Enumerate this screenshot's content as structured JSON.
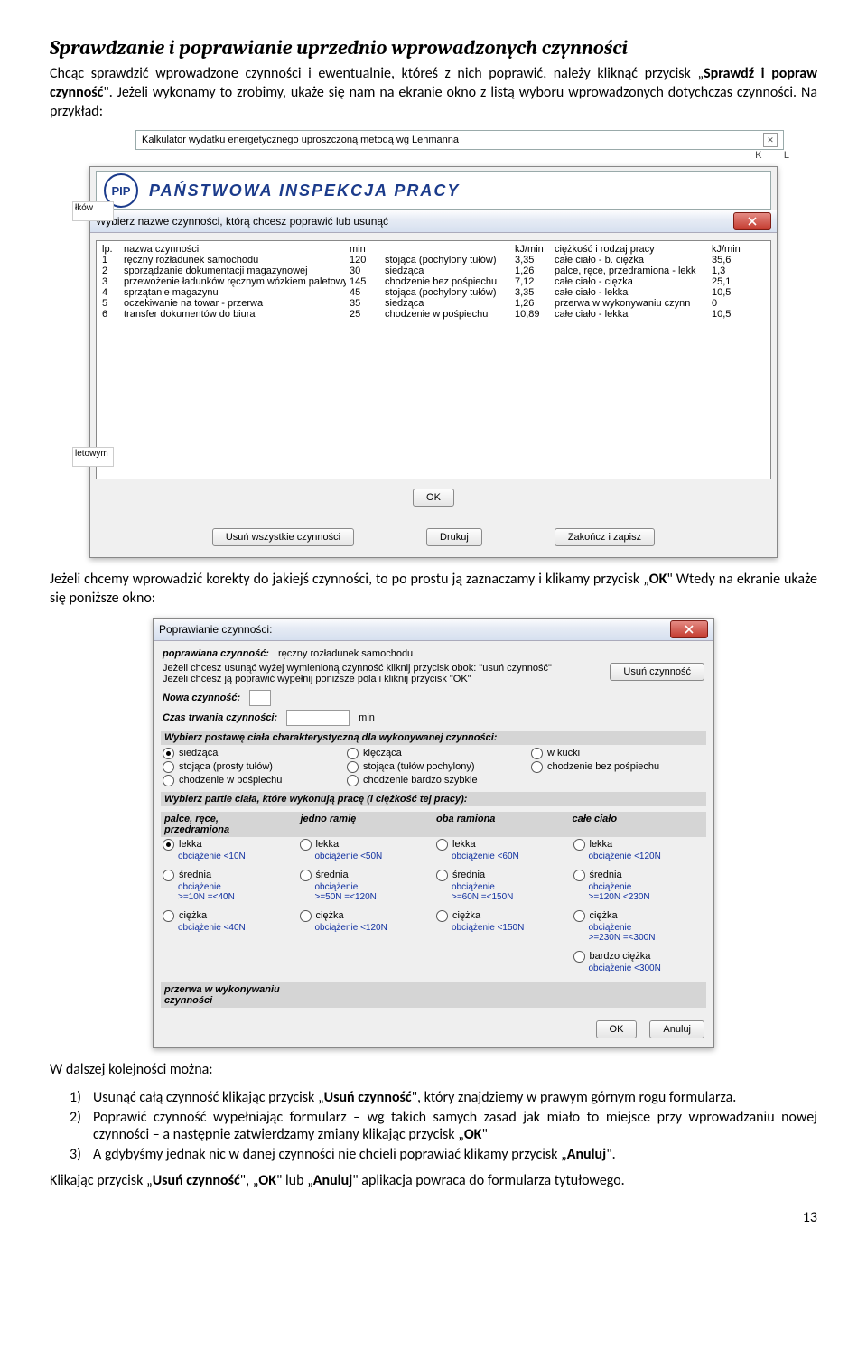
{
  "doc": {
    "heading": "Sprawdzanie i poprawianie uprzednio wprowadzonych czynności",
    "para1a": "Chcąc sprawdzić  wprowadzone czynności i ewentualnie, któreś z nich poprawić, należy kliknąć przycisk „",
    "para1b": "Sprawdź i popraw czynność",
    "para1c": "\". Jeżeli wykonamy to zrobimy, ukaże się nam na ekranie okno z listą wyboru wprowadzonych dotychczas czynności. Na przykład:",
    "para2a": "Jeżeli chcemy  wprowadzić korekty do jakiejś czynności, to po prostu ją zaznaczamy i klikamy przycisk „",
    "para2b": "OK",
    "para2c": "\"  Wtedy na ekranie ukaże się poniższe okno:",
    "para3": "W dalszej kolejności można:",
    "li1a": "Usunąć całą czynność klikając przycisk „",
    "li1b": "Usuń czynność",
    "li1c": "\", który znajdziemy  w prawym górnym rogu formularza.",
    "li2a": "Poprawić czynność wypełniając formularz – wg takich samych zasad jak miało to miejsce przy wprowadzaniu nowej czynności – a następnie zatwierdzamy zmiany klikając przycisk „",
    "li2b": "OK",
    "li2c": "\"",
    "li3a": "A gdybyśmy jednak nic w danej czynności nie chcieli poprawiać klikamy przycisk „",
    "li3b": "Anuluj",
    "li3c": "\".",
    "para4a": "Klikając przycisk  „",
    "para4b": "Usuń czynność",
    "para4c": "\", „",
    "para4d": "OK",
    "para4e": "\" lub „",
    "para4f": "Anuluj",
    "para4g": "\" aplikacja powraca do formularza tytułowego.",
    "pagenum": "13"
  },
  "outer": {
    "title": "Kalkulator wydatku energetycznego uproszczoną metodą wg Lehmanna",
    "colK": "K",
    "colL": "L",
    "stub1": "łków",
    "stub2": "letowym"
  },
  "dlg1": {
    "pip": "PAŃSTWOWA INSPEKCJA PRACY",
    "title": "Wybierz nazwe czynności, którą chcesz poprawić lub usunąć",
    "headers": {
      "c0": "lp.",
      "c1": "nazwa czynności",
      "c2": "min",
      "c3": "",
      "c4": "kJ/min",
      "c5": "ciężkość i rodzaj pracy",
      "c6": "kJ/min"
    },
    "rows": [
      {
        "n": "1",
        "name": "ręczny rozładunek samochodu",
        "min": "120",
        "pose": "stojąca (pochylony tułów)",
        "kj": "3,35",
        "work": "całe ciało - b. ciężka",
        "kj2": "35,6"
      },
      {
        "n": "2",
        "name": "sporządzanie dokumentacji magazynowej",
        "min": "30",
        "pose": "siedząca",
        "kj": "1,26",
        "work": "palce, ręce, przedramiona - lekk",
        "kj2": "1,3"
      },
      {
        "n": "3",
        "name": "przewożenie ładunków ręcznym wózkiem paletowym",
        "min": "145",
        "pose": "chodzenie bez pośpiechu",
        "kj": "7,12",
        "work": "całe ciało - ciężka",
        "kj2": "25,1"
      },
      {
        "n": "4",
        "name": "sprzątanie magazynu",
        "min": "45",
        "pose": "stojąca (pochylony tułów)",
        "kj": "3,35",
        "work": "całe ciało - lekka",
        "kj2": "10,5"
      },
      {
        "n": "5",
        "name": "oczekiwanie na towar - przerwa",
        "min": "35",
        "pose": "siedząca",
        "kj": "1,26",
        "work": "przerwa w wykonywaniu czynn",
        "kj2": "0"
      },
      {
        "n": "6",
        "name": "transfer dokumentów do biura",
        "min": "25",
        "pose": "chodzenie w pośpiechu",
        "kj": "10,89",
        "work": "całe ciało - lekka",
        "kj2": "10,5"
      }
    ],
    "ok": "OK",
    "b1": "Usuń wszystkie czynności",
    "b2": "Drukuj",
    "b3": "Zakończ i zapisz"
  },
  "dlg2": {
    "title": "Poprawianie czynności:",
    "editedLbl": "poprawiana czynność:",
    "editedVal": "ręczny rozładunek samochodu",
    "hint1": "Jeżeli chcesz usunąć wyżej wymienioną czynność kliknij przycisk obok:  \"usuń czynność\"",
    "hint2": "Jeżeli chcesz ją poprawić wypełnij poniższe pola i kliknij przycisk \"OK\"",
    "deleteBtn": "Usuń czynność",
    "newLbl": "Nowa czynność:",
    "durLbl": "Czas trwania czynności:",
    "durUnit": "min",
    "poseTitle": "Wybierz postawę ciała charakterystyczną dla wykonywanej czynności:",
    "poses": [
      "siedząca",
      "klęcząca",
      "w kucki",
      "stojąca (prosty tułów)",
      "stojąca (tułów pochylony)",
      "chodzenie bez pośpiechu",
      "chodzenie w pośpiechu",
      "chodzenie bardzo szybkie"
    ],
    "poseSelIndex": 0,
    "partsTitle": "Wybierz partie ciała, które wykonują pracę (i ciężkość tej pracy):",
    "partsHead": [
      "palce, ręce,\nprzedramiona",
      "jedno ramię",
      "oba ramiona",
      "całe ciało"
    ],
    "levels": [
      {
        "name": "lekka",
        "subs": [
          "obciążenie <10N",
          "obciążenie <50N",
          "obciążenie <60N",
          "obciążenie <120N"
        ]
      },
      {
        "name": "średnia",
        "subs": [
          "obciążenie\n>=10N  =<40N",
          "obciążenie\n>=50N  =<120N",
          "obciążenie\n>=60N  =<150N",
          "obciążenie\n>=120N  <230N"
        ]
      },
      {
        "name": "ciężka",
        "subs": [
          "obciążenie <40N",
          "obciążenie <120N",
          "obciążenie <150N",
          "obciążenie\n>=230N  =<300N"
        ]
      }
    ],
    "extraHeavy": {
      "name": "bardzo ciężka",
      "sub": "obciążenie <300N"
    },
    "partSel": {
      "col": 0,
      "row": 0
    },
    "breakLbl": "przerwa w wykonywaniu czynności",
    "ok": "OK",
    "cancel": "Anuluj"
  }
}
